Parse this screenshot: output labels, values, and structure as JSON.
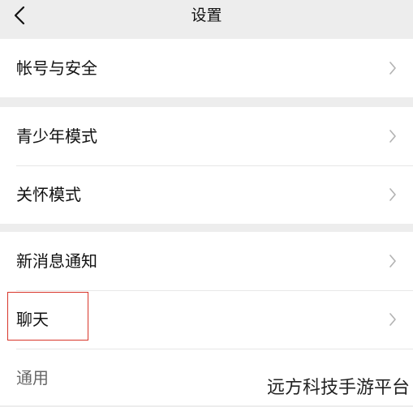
{
  "header": {
    "title": "设置",
    "back_icon": "chevron-left-icon"
  },
  "groups": [
    {
      "items": [
        {
          "label": "帐号与安全"
        }
      ]
    },
    {
      "items": [
        {
          "label": "青少年模式"
        },
        {
          "label": "关怀模式"
        }
      ]
    },
    {
      "items": [
        {
          "label": "新消息通知"
        },
        {
          "label": "聊天"
        },
        {
          "label": "通用"
        }
      ]
    }
  ],
  "highlight": {
    "target": "聊天",
    "color": "#d8352a"
  },
  "watermark": "远方科技手游平台",
  "colors": {
    "background": "#ededed",
    "card": "#ffffff",
    "text": "#111111",
    "chevron": "#b2b2b2"
  }
}
